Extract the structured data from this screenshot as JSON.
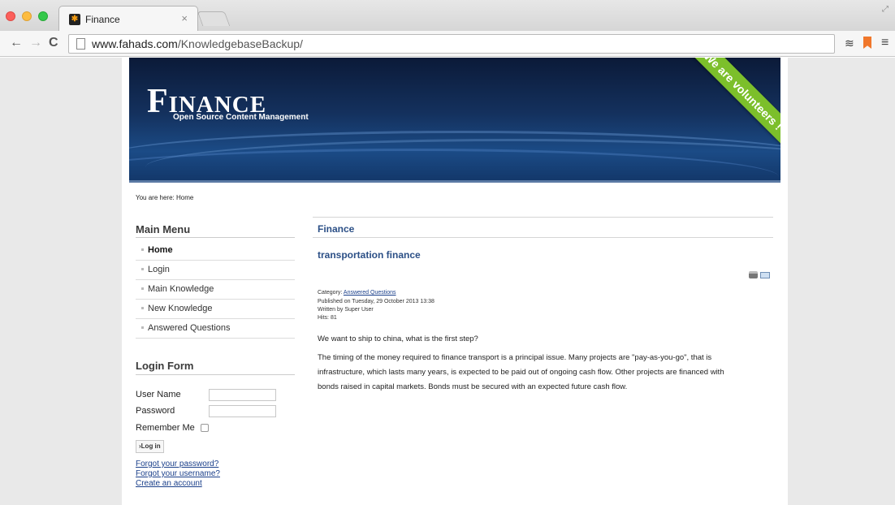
{
  "browser": {
    "tab_title": "Finance",
    "tab_close": "×",
    "url_host": "www.fahads.com",
    "url_path": "/KnowledgebaseBackup/"
  },
  "banner": {
    "title": "Finance",
    "subtitle": "Open Source Content Management",
    "ribbon": "We are volunteers !"
  },
  "breadcrumb": "You are here: Home",
  "main_menu": {
    "heading": "Main Menu",
    "items": [
      {
        "label": "Home"
      },
      {
        "label": "Login"
      },
      {
        "label": "Main Knowledge"
      },
      {
        "label": "New Knowledge"
      },
      {
        "label": "Answered Questions"
      }
    ]
  },
  "login_form": {
    "heading": "Login Form",
    "username_label": "User Name",
    "password_label": "Password",
    "remember_label": "Remember Me",
    "login_button": "›Log in",
    "forgot_password": "Forgot your password?",
    "forgot_username": "Forgot your username?",
    "create_account": "Create an account"
  },
  "content": {
    "heading": "Finance",
    "article_title": "transportation finance",
    "category_label": "Category: ",
    "category_link": "Answered Questions",
    "published": "Published on Tuesday, 29 October 2013 13:38",
    "written_by": "Written by Super User",
    "hits": "Hits: 81",
    "question": "We want to ship to china, what is the first step?",
    "paragraph_line1": "The timing of the money required to finance transport is a principal issue. Many projects are \"pay-as-you-go\", that is",
    "paragraph_line2": "infrastructure, which lasts many years, is expected to be paid out of ongoing cash flow. Other projects are financed with",
    "paragraph_line3": "bonds raised in capital markets. Bonds must be secured with an expected future cash flow."
  },
  "icons": {
    "print": "print-icon",
    "email": "email-icon"
  },
  "colors": {
    "link": "#1a3f8a",
    "heading_blue": "#2b4f86",
    "ribbon_green": "#7cbf2b",
    "banner_navy": "#14315e"
  }
}
